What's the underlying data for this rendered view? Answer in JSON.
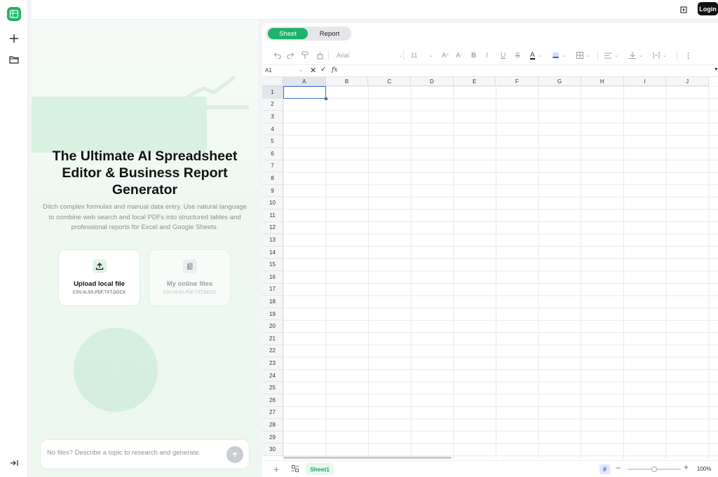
{
  "topbar": {
    "login_label": "Login"
  },
  "hero": {
    "title": "The Ultimate AI Spreadsheet Editor & Business Report Generator",
    "description": "Ditch complex formulas and manual data entry. Use natural language to combine web search and local PDFs into structured tables and professional reports for Excel and Google Sheets.",
    "upload": {
      "title": "Upload local file",
      "formats": "CSV,XLSX,PDF,TXT,DOCX"
    },
    "online": {
      "title": "My online files",
      "formats": "CSV,XLSX,PDF,TXT,DOCX"
    },
    "prompt_placeholder": "No files? Describe a topic to research and generate."
  },
  "sheet": {
    "tabs": {
      "sheet": "Sheet",
      "report": "Report"
    },
    "font_name": "Arial",
    "font_size": "11",
    "cell_ref": "A1",
    "fx_label": "fx",
    "columns": [
      "A",
      "B",
      "C",
      "D",
      "E",
      "F",
      "G",
      "H",
      "I",
      "J"
    ],
    "rows": [
      "1",
      "2",
      "3",
      "4",
      "5",
      "6",
      "7",
      "8",
      "9",
      "10",
      "11",
      "12",
      "13",
      "14",
      "15",
      "16",
      "17",
      "18",
      "19",
      "20",
      "21",
      "22",
      "23",
      "24",
      "25",
      "26",
      "27",
      "28",
      "29",
      "30"
    ],
    "sheet_tab": "Sheet1",
    "zoom": "100%"
  },
  "colors": {
    "brand": "#1fb26a",
    "selection": "#3b6fd4"
  }
}
